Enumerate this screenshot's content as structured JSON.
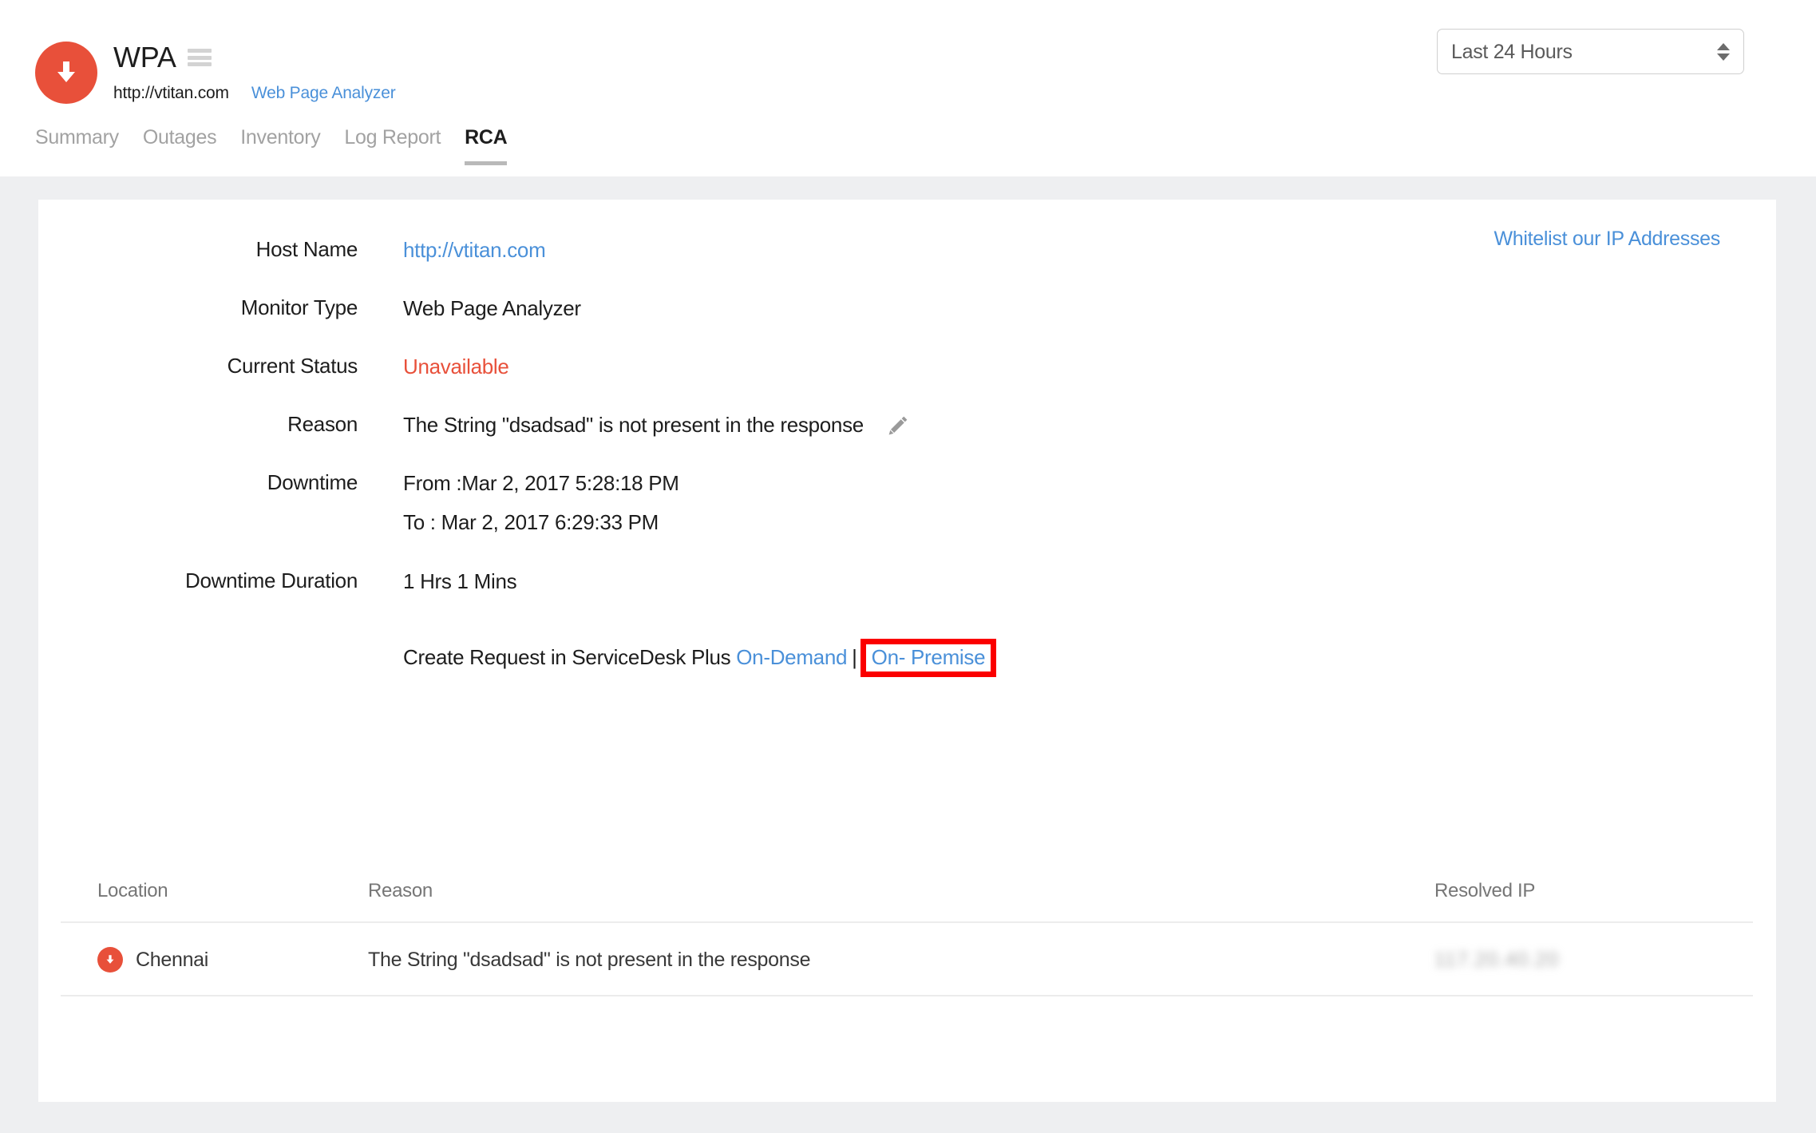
{
  "header": {
    "monitor_name": "WPA",
    "monitor_url": "http://vtitan.com",
    "monitor_type_link": "Web Page Analyzer",
    "logo_icon": "down-arrow-status-icon",
    "menu_icon": "hamburger-menu-icon",
    "period_selected": "Last 24 Hours",
    "period_options": [
      "Last 24 Hours"
    ],
    "tabs": [
      {
        "label": "Summary",
        "active": false
      },
      {
        "label": "Outages",
        "active": false
      },
      {
        "label": "Inventory",
        "active": false
      },
      {
        "label": "Log Report",
        "active": false
      },
      {
        "label": "RCA",
        "active": true
      }
    ]
  },
  "card": {
    "whitelist_link": "Whitelist our IP Addresses",
    "details": [
      {
        "label": "Host Name",
        "value": "http://vtitan.com",
        "style": "link"
      },
      {
        "label": "Monitor Type",
        "value": "Web Page Analyzer",
        "style": "plain"
      },
      {
        "label": "Current Status",
        "value": "Unavailable",
        "style": "danger"
      },
      {
        "label": "Reason",
        "value": "The String \"dsadsad\" is not present in the response",
        "style": "plain-edit"
      }
    ],
    "downtime": {
      "label": "Downtime",
      "from": "From :Mar 2, 2017 5:28:18 PM",
      "to": "To : Mar 2, 2017 6:29:33 PM"
    },
    "duration": {
      "label": "Downtime Duration",
      "value": "1 Hrs 1 Mins"
    },
    "request": {
      "prefix": "Create Request in ServiceDesk Plus ",
      "on_demand": "On-Demand",
      "separator": "|",
      "on_premise": "On- Premise",
      "highlight_color": "#fb0000"
    },
    "table": {
      "columns": [
        "Location",
        "Reason",
        "Resolved IP"
      ],
      "rows": [
        {
          "location": "Chennai",
          "location_icon": "down-arrow-status-icon",
          "reason": "The String \"dsadsad\" is not present in the response",
          "resolved_ip": "117.20.40.20",
          "resolved_ip_redacted": true
        }
      ]
    }
  },
  "colors": {
    "accent_red": "#e8503a",
    "link_blue": "#4a90d9",
    "page_background": "#eeeff1",
    "card_background": "#ffffff",
    "highlight_red": "#fb0000"
  }
}
